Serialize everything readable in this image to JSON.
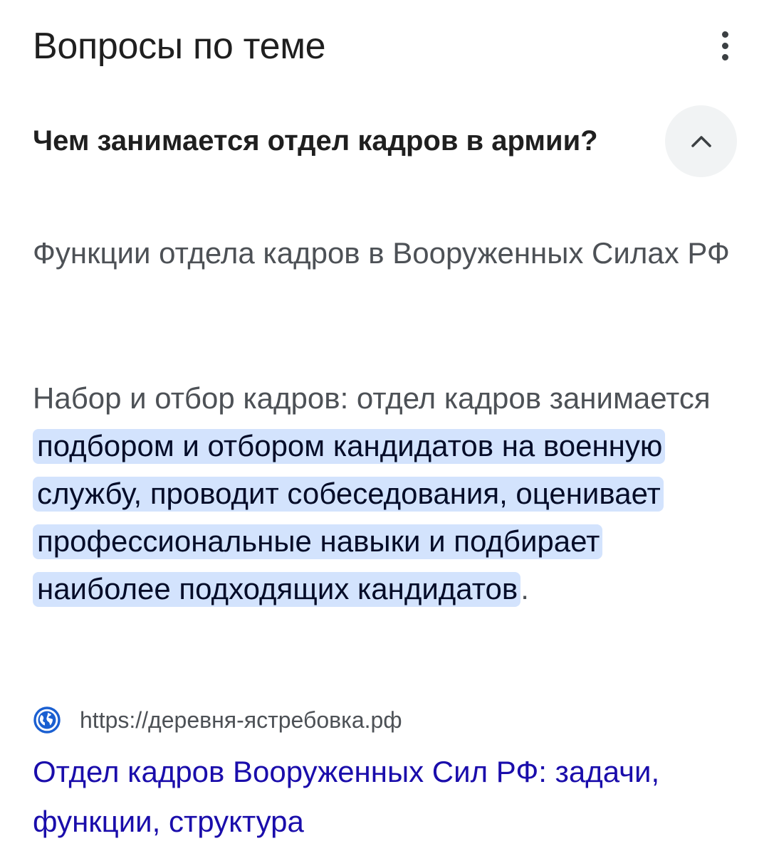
{
  "header": {
    "title": "Вопросы по теме",
    "menu_icon": "more-vert-icon"
  },
  "question": {
    "text": "Чем занимается отдел кадров в армии?",
    "expanded": true,
    "toggle_icon": "chevron-up-icon"
  },
  "answer": {
    "heading": "Функции отдела кадров в Вооруженных Силах РФ",
    "body_prefix": "Набор и отбор кадров: отдел кадров занимается ",
    "body_highlight": "подбором и отбором кандидатов на военную службу, проводит собеседования, оценивает профессиональные навыки и подбирает наиболее подходящих кандидатов",
    "body_suffix": "."
  },
  "source": {
    "icon": "globe-icon",
    "url": "https://деревня-ястребовка.рф",
    "link_title": "Отдел кадров Вооруженных Сил РФ: задачи, функции, структура"
  },
  "colors": {
    "title": "#1f1f1f",
    "body_text": "#4d5156",
    "highlight_bg": "#d3e3fd",
    "highlight_text": "#040c28",
    "link": "#1a0dab",
    "globe": "#1a5fd1",
    "toggle_bg": "#f1f3f4"
  }
}
